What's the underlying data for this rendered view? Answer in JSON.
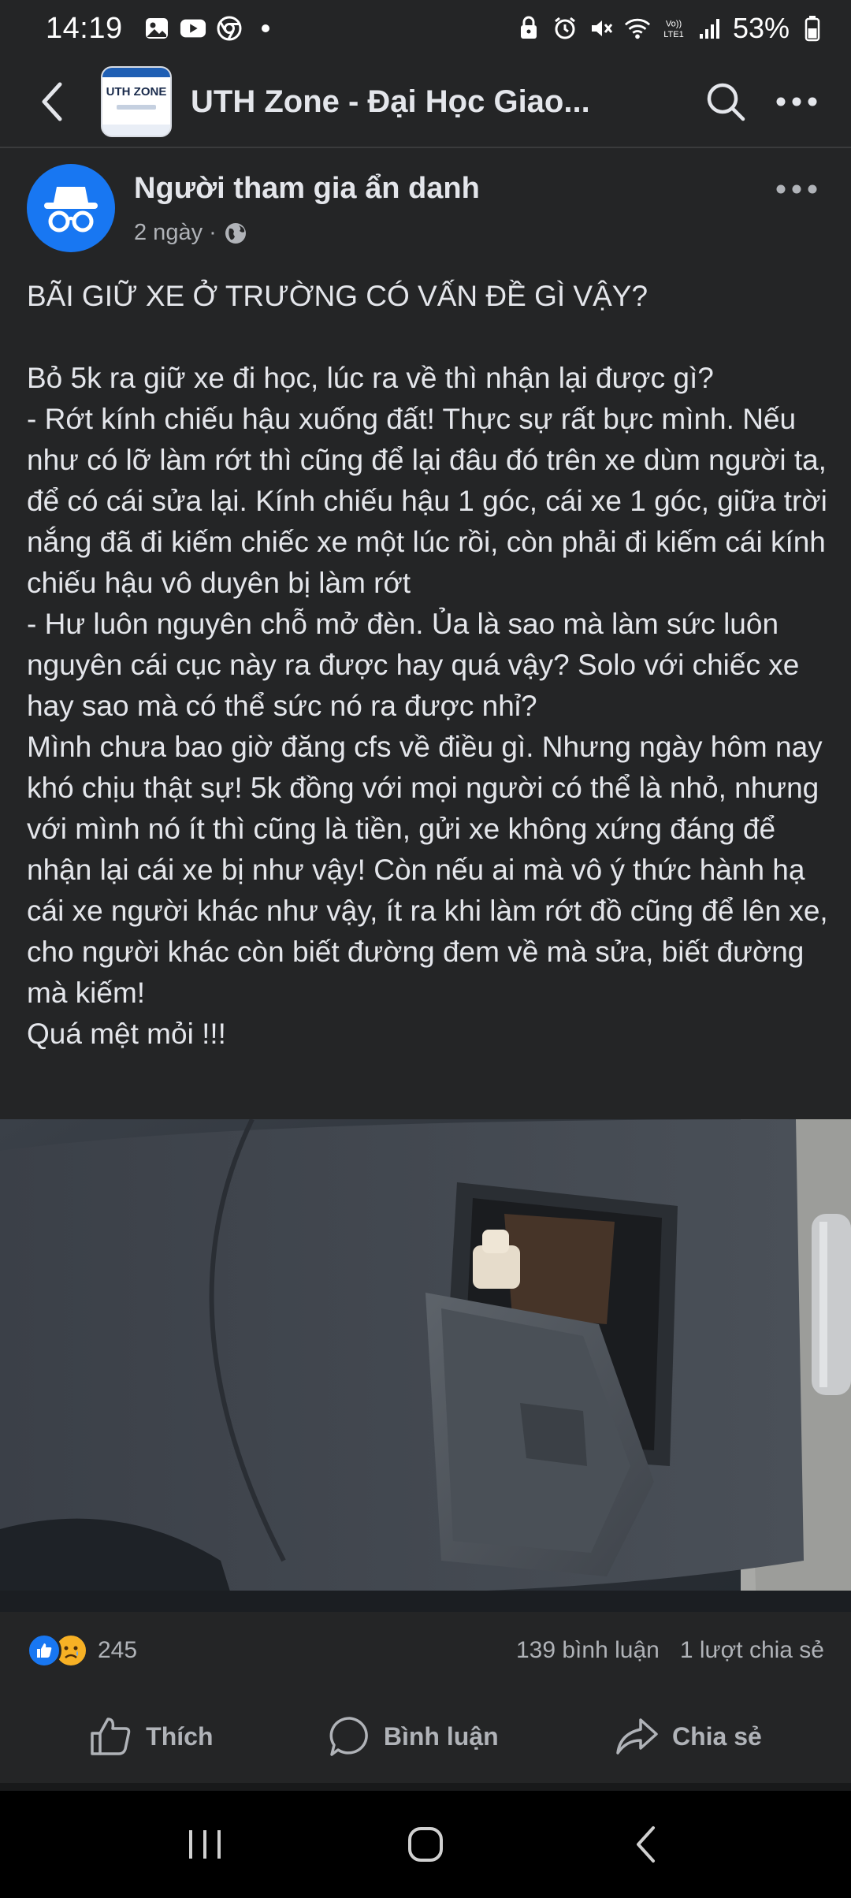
{
  "status_bar": {
    "time": "14:19",
    "battery": "53%",
    "left_icons": [
      "image-icon",
      "youtube-icon",
      "chrome-icon",
      "dot-icon"
    ],
    "right_icons": [
      "alarm-lock-icon",
      "alarm-icon",
      "mute-icon",
      "wifi-icon",
      "volte-icon",
      "signal-icon",
      "battery-icon"
    ]
  },
  "app_bar": {
    "group_title": "UTH Zone - Đại Học Giao...",
    "group_avatar_text": "UTH ZONE"
  },
  "post": {
    "author": "Người tham gia ẩn danh",
    "time": "2 ngày",
    "separator": "·",
    "privacy_icon": "globe-icon",
    "headline": "BÃI GIỮ XE Ở TRƯỜNG CÓ VẤN ĐỀ GÌ VẬY?",
    "paragraphs": [
      "Bỏ 5k ra giữ xe đi học, lúc ra về thì nhận lại được gì?",
      "- Rớt kính chiếu hậu xuống đất! Thực sự rất bực mình. Nếu như có lỡ làm rớt thì cũng để lại đâu đó trên xe dùm người ta, để có cái sửa lại. Kính chiếu hậu 1 góc, cái xe 1 góc, giữa trời nắng đã đi kiếm chiếc xe một lúc rồi, còn phải đi kiếm cái kính chiếu hậu vô duyên bị làm rớt",
      "- Hư luôn nguyên chỗ mở đèn. Ủa là sao mà làm sức luôn nguyên cái cục này ra được hay quá vậy? Solo với chiếc xe hay sao mà có thể sức nó ra được nhỉ?",
      "Mình chưa bao giờ đăng cfs về điều gì. Nhưng ngày hôm nay khó chịu thật sự! 5k đồng với mọi người có thể là nhỏ, nhưng với mình nó ít thì cũng là tiền, gửi xe không xứng đáng để nhận lại cái xe bị như vậy! Còn nếu ai mà vô ý thức hành hạ cái xe người khác như vậy, ít ra khi làm rớt đồ cũng để lên xe, cho người khác còn biết đường đem về mà sửa, biết đường mà kiếm!",
      "Quá mệt mỏi !!!"
    ]
  },
  "reactions": {
    "count": "245",
    "comments": "139 bình luận",
    "shares": "1 lượt chia sẻ",
    "icons": [
      "like-reaction-icon",
      "sad-reaction-icon"
    ]
  },
  "actions": {
    "like": "Thích",
    "comment": "Bình luận",
    "share": "Chia sẻ"
  },
  "colors": {
    "background": "#242526",
    "text": "#e4e6eb",
    "secondary_text": "#b0b3b8",
    "accent": "#1877f2"
  }
}
